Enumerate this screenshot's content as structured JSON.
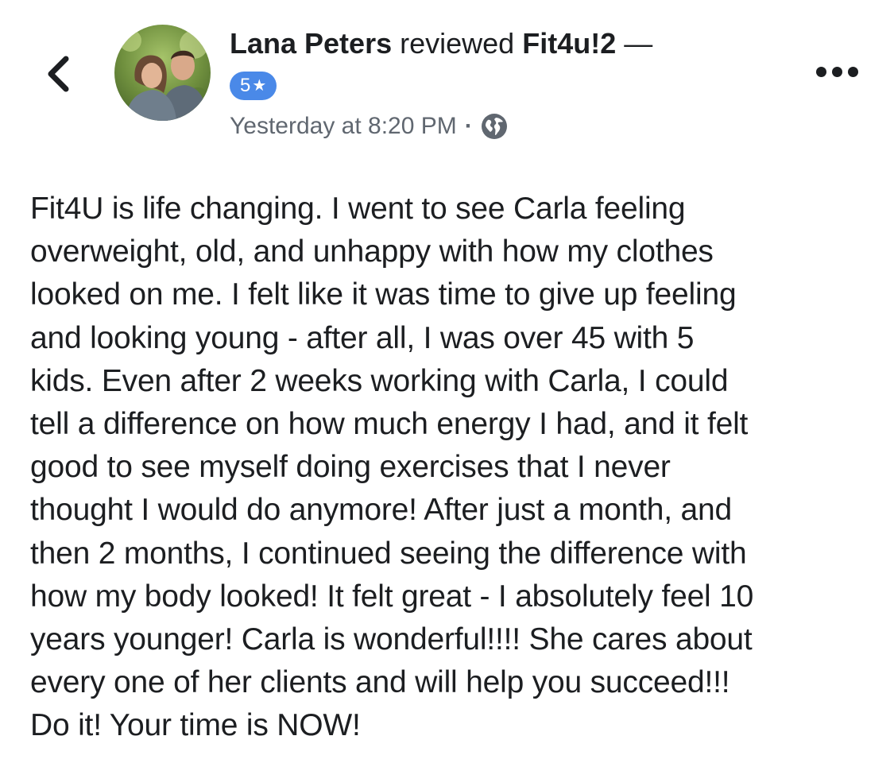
{
  "nav": {
    "back_icon": "chevron-left-icon",
    "more_icon": "more-horizontal-icon"
  },
  "post": {
    "author_name": "Lana Peters",
    "action_text": "reviewed",
    "page_name": "Fit4u!2",
    "dash": "—",
    "rating": {
      "value": "5",
      "star_glyph": "★",
      "color": "#4a89e8"
    },
    "timestamp": "Yesterday at 8:20 PM",
    "separator": "·",
    "privacy_icon": "globe-icon",
    "review_text": "Fit4U is life changing.  I went to see Carla feeling\noverweight, old, and unhappy with how my clothes\nlooked on me.  I felt like it was time to give up feeling\nand looking young - after all, I was over 45 with 5\nkids.  Even after 2 weeks working with Carla, I could\ntell a difference on how much energy I had, and it felt\ngood to see myself doing exercises that I never\nthought I would do anymore!  After just a month, and\nthen 2 months, I continued seeing the difference with\nhow my body looked!  It felt great - I absolutely feel 10\nyears younger!  Carla is wonderful!!!!  She cares about\nevery one of her clients and will help you succeed!!!\nDo it!  Your time is NOW!"
  },
  "colors": {
    "text_primary": "#1c1e21",
    "text_secondary": "#606770",
    "badge_blue": "#4a89e8",
    "background": "#ffffff"
  }
}
